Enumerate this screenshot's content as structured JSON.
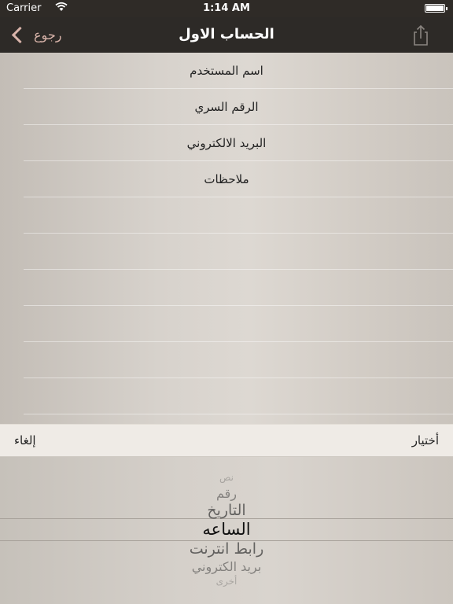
{
  "status": {
    "carrier": "Carrier",
    "time": "1:14 AM",
    "battery_level": 1.0
  },
  "nav": {
    "back_label": "رجوع",
    "title": "الحساب الاول"
  },
  "fields": [
    {
      "label": "اسم المستخدم"
    },
    {
      "label": "الرقم السري"
    },
    {
      "label": "البريد الالكتروني"
    },
    {
      "label": "ملاحظات"
    }
  ],
  "toolbar": {
    "cancel_label": "إلغاء",
    "choose_label": "أختيار"
  },
  "picker": {
    "options": [
      "نص",
      "رقم",
      "التاريخ",
      "الساعه",
      "رابط انترنت",
      "بريد الكتروني",
      "أخرى"
    ],
    "selected_index": 3
  },
  "colors": {
    "nav_bg": "#2d2a27",
    "back_tint": "#d9b4aa",
    "toolbar_bg": "#efebe6"
  }
}
